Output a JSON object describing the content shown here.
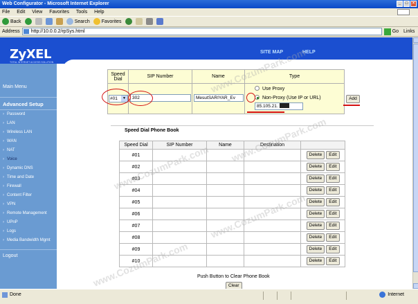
{
  "window": {
    "title": "Web Configurator - Microsoft Internet Explorer"
  },
  "menubar": [
    "File",
    "Edit",
    "View",
    "Favorites",
    "Tools",
    "Help"
  ],
  "toolbar": {
    "back": "Back",
    "search": "Search",
    "favorites": "Favorites"
  },
  "addressbar": {
    "label": "Address",
    "url": "http://10.0.0.2/rpSys.html",
    "go": "Go",
    "links": "Links"
  },
  "statusbar": {
    "text": "Done",
    "zone": "Internet"
  },
  "header": {
    "logo": "ZyXEL",
    "tagline": "TOTAL INTERNET ACCESS SOLUTION",
    "site_map": "SITE MAP",
    "help": "HELP"
  },
  "sidebar": {
    "main_menu": "Main Menu",
    "advanced_setup": "Advanced Setup",
    "items": [
      {
        "label": "Password"
      },
      {
        "label": "LAN"
      },
      {
        "label": "Wireless LAN"
      },
      {
        "label": "WAN"
      },
      {
        "label": "NAT"
      },
      {
        "label": "Voice",
        "active": true
      },
      {
        "label": "Dynamic DNS"
      },
      {
        "label": "Time and Date"
      },
      {
        "label": "Firewall"
      },
      {
        "label": "Content Filter"
      },
      {
        "label": "VPN"
      },
      {
        "label": "Remote Management"
      },
      {
        "label": "UPnP"
      },
      {
        "label": "Logs"
      },
      {
        "label": "Media Bandwidth Mgmt"
      }
    ],
    "logout": "Logout"
  },
  "entry": {
    "headers": {
      "speed_dial": "Speed Dial",
      "sip_number": "SIP Number",
      "name": "Name",
      "type": "Type"
    },
    "speed_dial_value": "#01",
    "sip_number_value": "302",
    "name_value": "MesutSARIYAR_Ev",
    "use_proxy_label": "Use Proxy",
    "non_proxy_label": "Non-Proxy (Use IP or URL)",
    "ip_value": "85.105.21.",
    "add_label": "Add"
  },
  "phonebook": {
    "title": "Speed Dial Phone Book",
    "headers": [
      "Speed Dial",
      "SIP Number",
      "Name",
      "Destination"
    ],
    "rows": [
      "#01",
      "#02",
      "#03",
      "#04",
      "#05",
      "#06",
      "#07",
      "#08",
      "#09",
      "#10"
    ],
    "delete_label": "Delete",
    "edit_label": "Edit"
  },
  "clear": {
    "note": "Push Button to Clear Phone Book",
    "label": "Clear"
  },
  "watermark": "www.CozumPark.com",
  "colors": {
    "brand": "#1b4fd0",
    "sidebar": "#6a9bd2",
    "annotation": "#d41010",
    "table_bg": "#fdfdd4"
  }
}
